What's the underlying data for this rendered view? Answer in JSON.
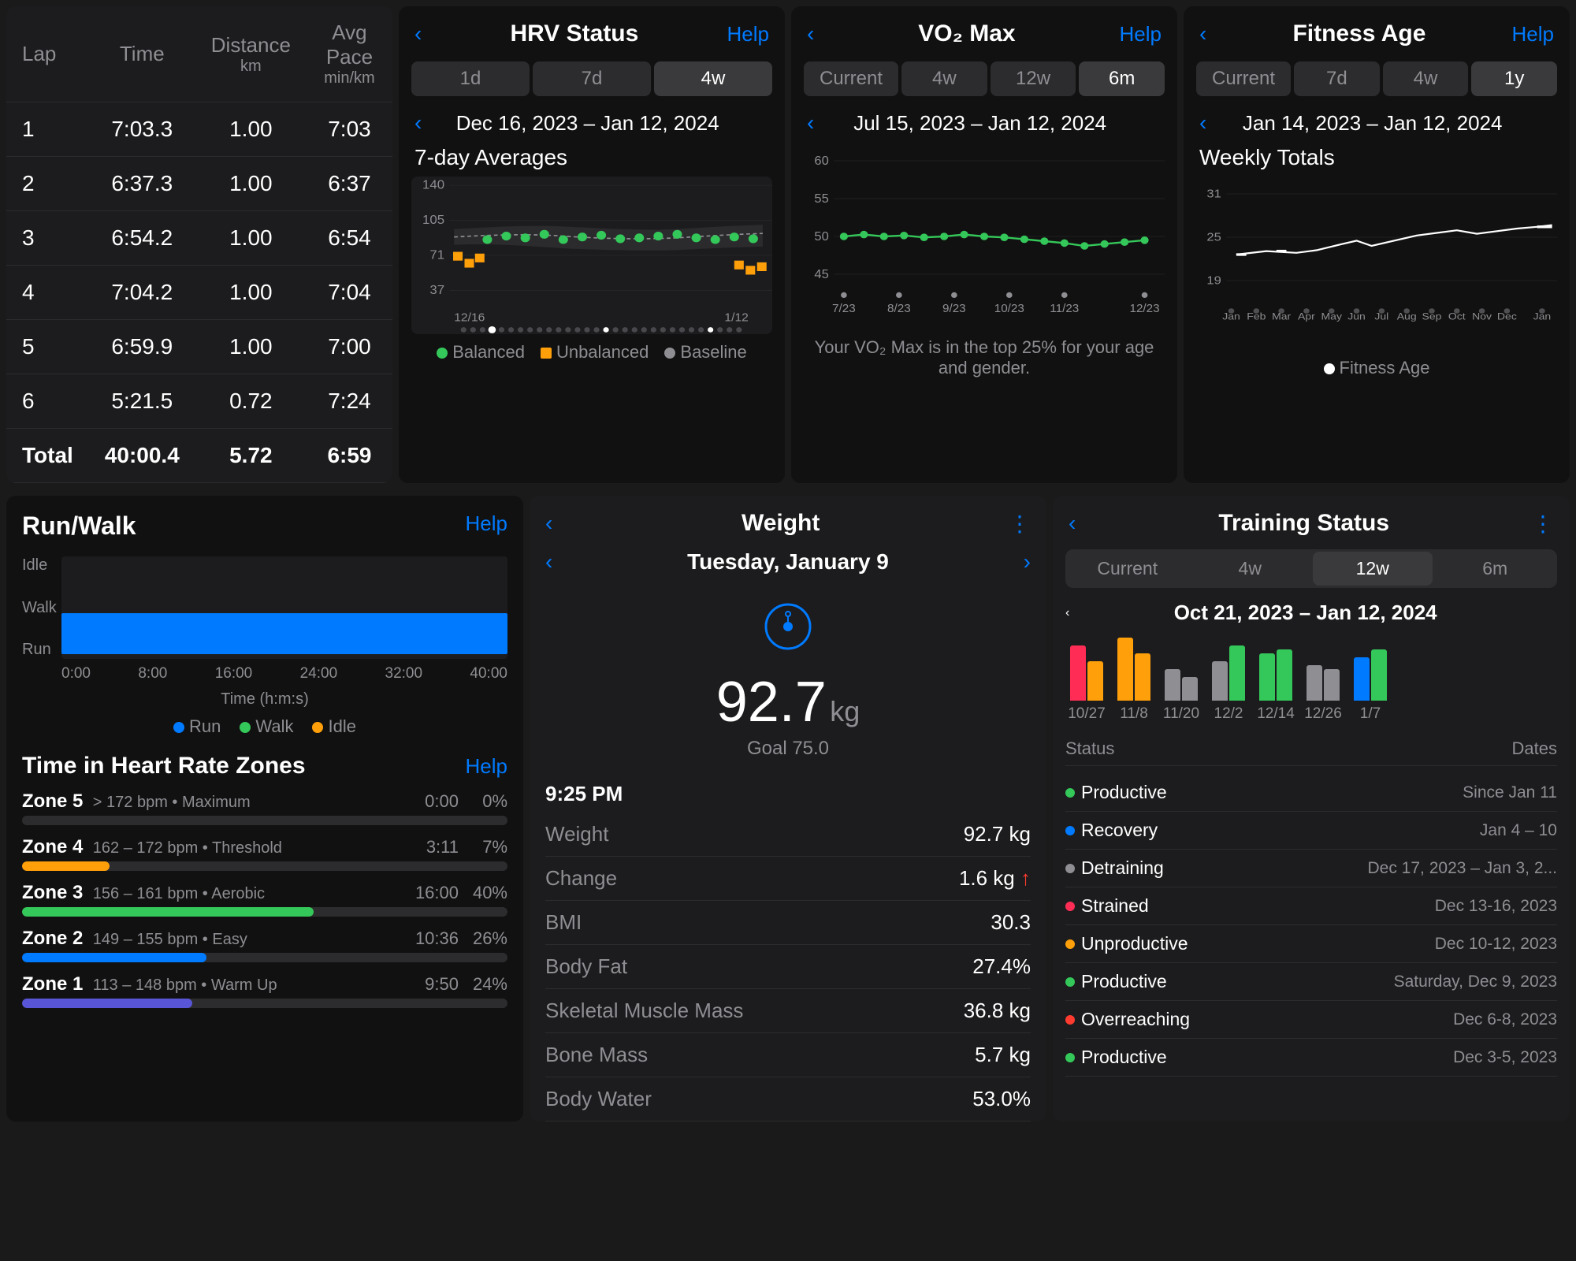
{
  "lapTable": {
    "headers": [
      "Lap",
      "Time",
      "Distance\nkm",
      "Avg Pace\nmin/km"
    ],
    "rows": [
      {
        "lap": "1",
        "time": "7:03.3",
        "distance": "1.00",
        "pace": "7:03"
      },
      {
        "lap": "2",
        "time": "6:37.3",
        "distance": "1.00",
        "pace": "6:37"
      },
      {
        "lap": "3",
        "time": "6:54.2",
        "distance": "1.00",
        "pace": "6:54"
      },
      {
        "lap": "4",
        "time": "7:04.2",
        "distance": "1.00",
        "pace": "7:04"
      },
      {
        "lap": "5",
        "time": "6:59.9",
        "distance": "1.00",
        "pace": "7:00"
      },
      {
        "lap": "6",
        "time": "5:21.5",
        "distance": "0.72",
        "pace": "7:24"
      }
    ],
    "total": {
      "label": "Total",
      "time": "40:00.4",
      "distance": "5.72",
      "pace": "6:59"
    }
  },
  "hrv": {
    "title": "HRV Status",
    "help": "Help",
    "back": "‹",
    "tabs": [
      "1d",
      "7d",
      "4w"
    ],
    "activeTab": "4w",
    "dateRange": "Dec 16, 2023 – Jan 12, 2024",
    "sectionTitle": "7-day Averages",
    "yLabels": [
      "140",
      "105",
      "71",
      "37"
    ],
    "xLabels": [
      "12/16",
      "1/12"
    ],
    "legend": {
      "balanced": "Balanced",
      "unbalanced": "Unbalanced",
      "baseline": "Baseline"
    }
  },
  "vo2": {
    "title": "VO₂ Max",
    "help": "Help",
    "back": "‹",
    "tabs": [
      "Current",
      "4w",
      "12w",
      "6m"
    ],
    "activeTab": "6m",
    "dateRange": "Jul 15, 2023 – Jan 12, 2024",
    "yLabels": [
      "60",
      "55",
      "50",
      "45"
    ],
    "xLabels": [
      "7/23",
      "8/23",
      "9/23",
      "10/23",
      "11/23",
      "12/23"
    ],
    "footerText": "Your VO₂ Max is in the top 25% for your age\nand gender."
  },
  "fitnessAge": {
    "title": "Fitness Age",
    "help": "Help",
    "back": "‹",
    "tabs": [
      "Current",
      "7d",
      "4w",
      "1y"
    ],
    "activeTab": "1y",
    "dateRange": "Jan 14, 2023 – Jan 12, 2024",
    "sectionTitle": "Weekly Totals",
    "yLabels": [
      "31",
      "25",
      "19"
    ],
    "xLabels": [
      "Jan",
      "Feb",
      "Mar",
      "Apr",
      "May",
      "Jun",
      "Jul",
      "Aug",
      "Sep",
      "Oct",
      "Nov",
      "Dec",
      "Jan"
    ],
    "legend": {
      "fitnessAge": "Fitness Age"
    }
  },
  "runWalk": {
    "title": "Run/Walk",
    "help": "Help",
    "yLabels": [
      "Idle",
      "Walk",
      "Run"
    ],
    "xLabels": [
      "0:00",
      "8:00",
      "16:00",
      "24:00",
      "32:00",
      "40:00"
    ],
    "xTitle": "Time (h:m:s)",
    "legend": [
      {
        "label": "Run",
        "color": "#007aff"
      },
      {
        "label": "Walk",
        "color": "#34c759"
      },
      {
        "label": "Idle",
        "color": "#ff9f0a"
      }
    ],
    "zonesTitle": "Time in Heart Rate Zones",
    "zonesHelp": "Help",
    "zones": [
      {
        "name": "Zone 5",
        "bpm": "> 172 bpm",
        "desc": "Maximum",
        "time": "0:00",
        "pct": "0%",
        "color": "#ff3b30",
        "fillPct": 0
      },
      {
        "name": "Zone 4",
        "bpm": "162 – 172 bpm",
        "desc": "Threshold",
        "time": "3:11",
        "pct": "7%",
        "color": "#ff9f0a",
        "fillPct": 18
      },
      {
        "name": "Zone 3",
        "bpm": "156 – 161 bpm",
        "desc": "Aerobic",
        "time": "16:00",
        "pct": "40%",
        "color": "#34c759",
        "fillPct": 60
      },
      {
        "name": "Zone 2",
        "bpm": "149 – 155 bpm",
        "desc": "Easy",
        "time": "10:36",
        "pct": "26%",
        "color": "#007aff",
        "fillPct": 38
      },
      {
        "name": "Zone 1",
        "bpm": "113 – 148 bpm",
        "desc": "Warm Up",
        "time": "9:50",
        "pct": "24%",
        "color": "#5856d6",
        "fillPct": 35
      }
    ]
  },
  "weight": {
    "title": "Weight",
    "back": "‹",
    "menu": "⋮",
    "date": "Tuesday, January 9",
    "time": "9:25 PM",
    "value": "92.7",
    "unit": "kg",
    "goal": "Goal 75.0",
    "metrics": [
      {
        "label": "Weight",
        "value": "92.7 kg"
      },
      {
        "label": "Change",
        "value": "1.6 kg ↑"
      },
      {
        "label": "BMI",
        "value": "30.3"
      },
      {
        "label": "Body Fat",
        "value": "27.4%"
      },
      {
        "label": "Skeletal Muscle Mass",
        "value": "36.8 kg"
      },
      {
        "label": "Bone Mass",
        "value": "5.7 kg"
      },
      {
        "label": "Body Water",
        "value": "53.0%"
      }
    ]
  },
  "trainingStatus": {
    "title": "Training Status",
    "back": "‹",
    "menu": "⋮",
    "tabs": [
      "Current",
      "4w",
      "12w",
      "6m"
    ],
    "activeTab": "12w",
    "dateRange": "Oct 21, 2023 – Jan 12, 2024",
    "weekLabels": [
      "10/27",
      "11/8",
      "11/20",
      "12/2",
      "12/14",
      "12/26",
      "1/7"
    ],
    "statusTable": [
      {
        "status": "Productive",
        "dot": "#34c759",
        "dates": "Since Jan 11"
      },
      {
        "status": "Recovery",
        "dot": "#007aff",
        "dates": "Jan 4 – 10"
      },
      {
        "status": "Detraining",
        "dot": "#8e8e93",
        "dates": "Dec 17, 2023 – Jan 3, 2..."
      },
      {
        "status": "Strained",
        "dot": "#ff2d55",
        "dates": "Dec 13-16, 2023"
      },
      {
        "status": "Unproductive",
        "dot": "#ff9f0a",
        "dates": "Dec 10-12, 2023"
      },
      {
        "status": "Productive",
        "dot": "#34c759",
        "dates": "Saturday, Dec 9, 2023"
      },
      {
        "status": "Overreaching",
        "dot": "#ff3b30",
        "dates": "Dec 6-8, 2023"
      },
      {
        "status": "Productive",
        "dot": "#34c759",
        "dates": "Dec 3-5, 2023"
      }
    ],
    "tableHeaders": {
      "status": "Status",
      "dates": "Dates"
    },
    "weekBars": [
      {
        "colors": [
          "#ff2d55",
          "#ff9f0a"
        ],
        "heights": [
          70,
          50
        ]
      },
      {
        "colors": [
          "#ff9f0a",
          "#ff9f0a"
        ],
        "heights": [
          80,
          60
        ]
      },
      {
        "colors": [
          "#8e8e93",
          "#8e8e93"
        ],
        "heights": [
          40,
          30
        ]
      },
      {
        "colors": [
          "#8e8e93",
          "#34c759"
        ],
        "heights": [
          50,
          70
        ]
      },
      {
        "colors": [
          "#34c759",
          "#34c759"
        ],
        "heights": [
          60,
          65
        ]
      },
      {
        "colors": [
          "#8e8e93",
          "#8e8e93"
        ],
        "heights": [
          45,
          40
        ]
      },
      {
        "colors": [
          "#007aff",
          "#34c759"
        ],
        "heights": [
          55,
          65
        ]
      }
    ]
  }
}
